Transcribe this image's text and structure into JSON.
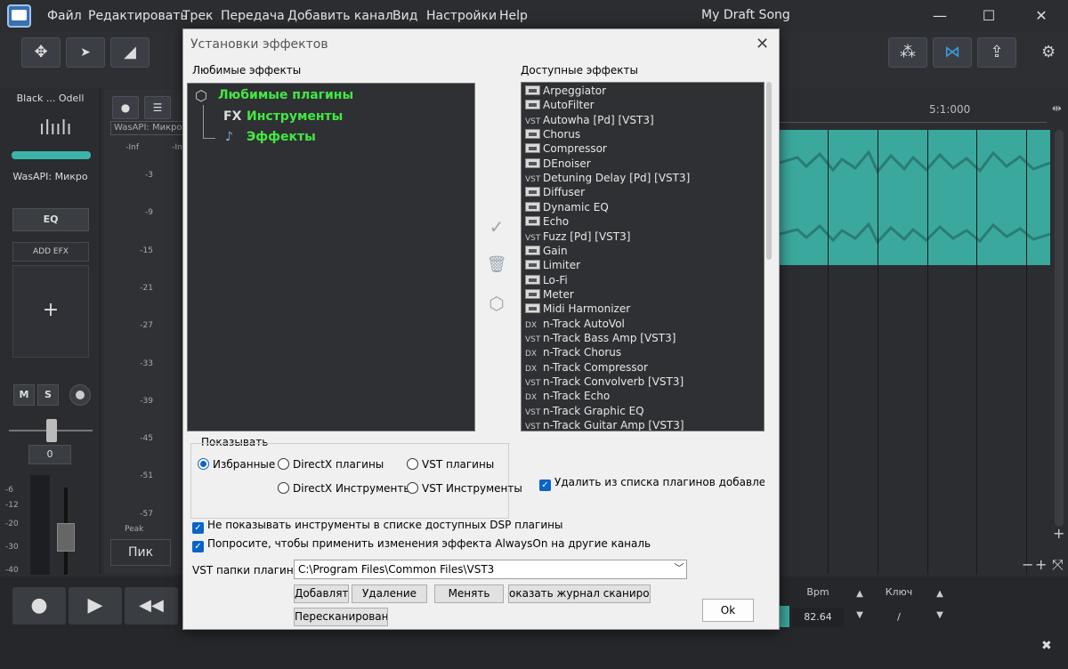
{
  "app": {
    "menu": [
      "Файл",
      "Редактировать",
      "Трек",
      "Передача",
      "Добавить канал",
      "Вид",
      "Настройки",
      "Help"
    ],
    "song_title": "My Draft Song",
    "window_buttons": {
      "minimize": "—",
      "maximize": "☐",
      "close": "✕"
    }
  },
  "toolbar": {
    "move_icon": "✥",
    "pointer_icon": "➤",
    "ramp_icon": "◢",
    "share_icon": "⋈",
    "export_icon": "⇪",
    "gear_icon": "⚙"
  },
  "track": {
    "name": "Black ... Odell",
    "wave_icon": "ılıılı",
    "input": "WasAPI: Микро",
    "eq_label": "EQ",
    "addefx_label": "ADD EFX",
    "plus": "+",
    "mute": "M",
    "solo": "S",
    "pan_value": "0",
    "vol_scale": [
      "-6",
      "-12",
      "-20",
      "-30",
      "-40"
    ]
  },
  "mixer": {
    "rec": "●",
    "menu": "☰",
    "input": "WasAPI: Микро",
    "inf_left": "-Inf",
    "inf_right": "-Inf",
    "db_scale": [
      "-3",
      "-9",
      "-15",
      "-21",
      "-27",
      "-33",
      "-39",
      "-45",
      "-51",
      "-57"
    ],
    "peak": "Peak",
    "pik_button": "Пик"
  },
  "arrangement": {
    "ruler_mark": "5:1:000",
    "zoom_minus": "−",
    "zoom_plus": "+"
  },
  "transport": {
    "record": "●",
    "play": "▶",
    "rewind": "◀◀",
    "bpm_label": "Bpm",
    "bpm_value": "82.64",
    "key_label": "Ключ",
    "key_value": "/",
    "spin_up": "▲",
    "spin_down": "▼"
  },
  "status": {
    "close": "✖"
  },
  "dialog": {
    "title": "Установки эффектов",
    "close": "✕",
    "favorites_label": "Любимые эффекты",
    "available_label": "Доступные эффекты",
    "tree": {
      "root": "Любимые плагины",
      "instruments_prefix": "FX",
      "instruments": "Инструменты",
      "effects": "Эффекты"
    },
    "plugins": [
      {
        "tag": "icon",
        "name": "Arpeggiator"
      },
      {
        "tag": "icon",
        "name": "AutoFilter"
      },
      {
        "tag": "VST",
        "name": "Autowha [Pd] [VST3]"
      },
      {
        "tag": "icon",
        "name": "Chorus"
      },
      {
        "tag": "icon",
        "name": "Compressor"
      },
      {
        "tag": "icon",
        "name": "DEnoiser"
      },
      {
        "tag": "VST",
        "name": "Detuning Delay [Pd]  [VST3]"
      },
      {
        "tag": "icon",
        "name": "Diffuser"
      },
      {
        "tag": "icon",
        "name": "Dynamic EQ"
      },
      {
        "tag": "icon",
        "name": "Echo"
      },
      {
        "tag": "VST",
        "name": "Fuzz [Pd]  [VST3]"
      },
      {
        "tag": "icon",
        "name": "Gain"
      },
      {
        "tag": "icon",
        "name": "Limiter"
      },
      {
        "tag": "icon",
        "name": "Lo-Fi"
      },
      {
        "tag": "icon",
        "name": "Meter"
      },
      {
        "tag": "icon",
        "name": "Midi Harmonizer"
      },
      {
        "tag": "DX",
        "name": "n-Track AutoVol"
      },
      {
        "tag": "VST",
        "name": "n-Track Bass Amp [VST3]"
      },
      {
        "tag": "DX",
        "name": "n-Track Chorus"
      },
      {
        "tag": "DX",
        "name": "n-Track Compressor"
      },
      {
        "tag": "VST",
        "name": "n-Track Convolverb [VST3]"
      },
      {
        "tag": "DX",
        "name": "n-Track Echo"
      },
      {
        "tag": "VST",
        "name": "n-Track Graphic EQ"
      },
      {
        "tag": "VST",
        "name": "n-Track Guitar Amp [VST3]"
      }
    ],
    "side_icons": {
      "check": "✓",
      "trash": "🗑",
      "box": "⬡"
    },
    "show_label": "Показывать",
    "show_options": {
      "favorites": "Избранные",
      "dx_plugins": "DirectX плагины",
      "vst_plugins": "VST плагины",
      "dx_instruments": "DirectX Инструменты",
      "vst_instruments": "VST Инструменты"
    },
    "remove_added": "Удалить из списка плагинов добавлены в и:",
    "hide_instruments": "Не показывать инструменты в списке доступных DSP плагины",
    "ask_alwayson": "Попросите, чтобы применить изменения эффекта AlwaysOn на другие каналь",
    "vst_folders_label": "VST папки плагино",
    "vst_path": "C:\\Program Files\\Common Files\\VST3",
    "dropdown_arrow": "﹀",
    "buttons": {
      "add": "Добавлять",
      "remove": "Удаление",
      "change": "Менять",
      "show_log": "оказать журнал сканировани",
      "rescan": "Пересканирование",
      "ok": "Ok"
    }
  }
}
